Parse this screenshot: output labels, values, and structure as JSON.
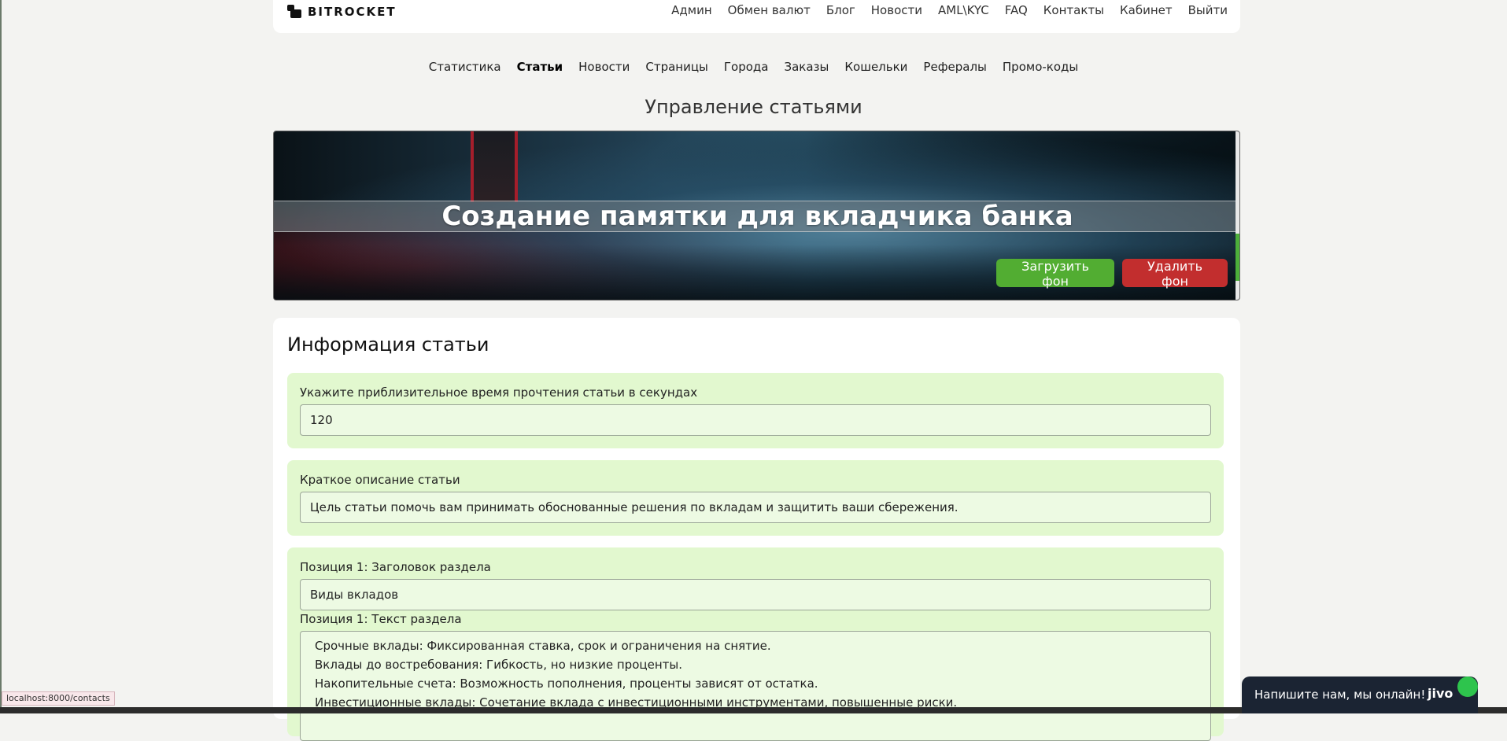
{
  "header": {
    "logo_text": "BITROCKET",
    "nav": [
      "Админ",
      "Обмен валют",
      "Блог",
      "Новости",
      "AML\\KYC",
      "FAQ",
      "Контакты",
      "Кабинет",
      "Выйти"
    ]
  },
  "sub_nav": {
    "items": [
      "Статистика",
      "Статьи",
      "Новости",
      "Страницы",
      "Города",
      "Заказы",
      "Кошельки",
      "Рефералы",
      "Промо-коды"
    ],
    "active": "Статьи"
  },
  "section_title": "Управление статьями",
  "banner": {
    "title": "Создание памятки для вкладчика банка",
    "upload_label": "Загрузить фон",
    "delete_label": "Удалить фон"
  },
  "article_info": {
    "title": "Информация статьи",
    "read_time": {
      "label": "Укажите приблизительное время прочтения статьи в секундах",
      "value": "120"
    },
    "short_description": {
      "label": "Краткое описание статьи",
      "value": "Цель статьи помочь вам принимать обоснованные решения по вкладам и защитить ваши сбережения."
    },
    "position1": {
      "title_label": "Позиция 1: Заголовок раздела",
      "title_value": "Виды вкладов",
      "text_label": "Позиция 1: Текст раздела",
      "text_lines": [
        "Срочные вклады: Фиксированная ставка, срок и ограничения на снятие.",
        "Вклады до востребования: Гибкость, но низкие проценты.",
        "Накопительные счета: Возможность пополнения, проценты зависят от остатка.",
        "Инвестиционные вклады: Сочетание вклада с инвестиционными инструментами, повышенные риски."
      ]
    }
  },
  "status_url": "localhost:8000/contacts",
  "jivo": {
    "text": "Напишите нам, мы онлайн!",
    "brand": "jivo"
  },
  "colors": {
    "accent_green": "#52ad32",
    "danger_red": "#c22e2e",
    "field_block_bg": "#e2f8cf"
  }
}
